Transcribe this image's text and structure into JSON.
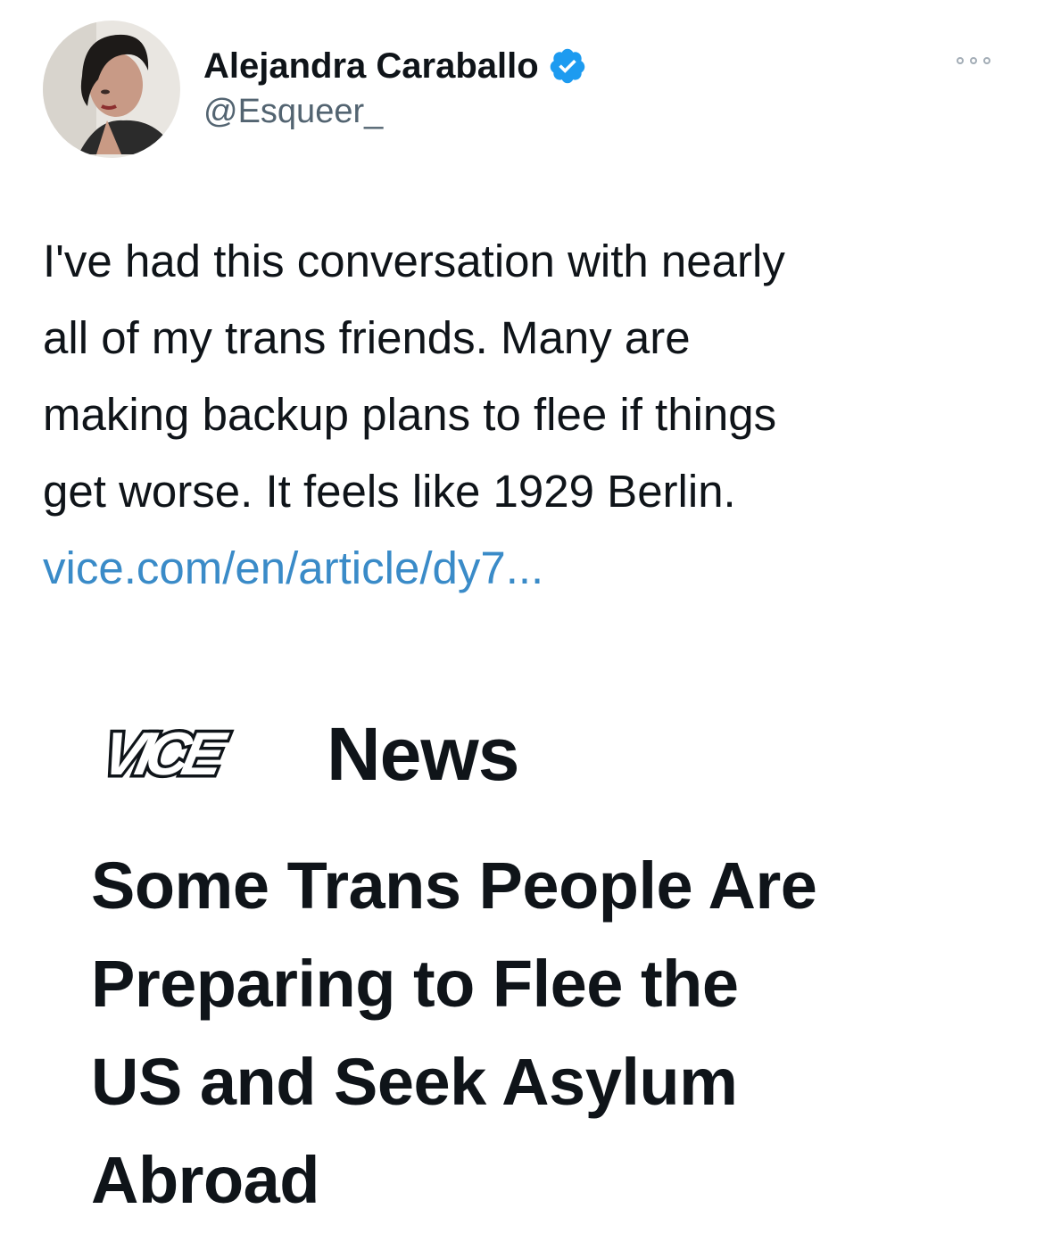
{
  "author": {
    "name": "Alejandra Caraballo",
    "handle": "@Esqueer_",
    "verified": true
  },
  "more_icon": "more-horizontal-icon",
  "tweet": {
    "text_lines": [
      "I've had this conversation with nearly",
      "all of my trans friends. Many are",
      "making backup plans to flee if things",
      "get worse. It feels like 1929 Berlin."
    ],
    "link_text": "vice.com/en/article/dy7..."
  },
  "card": {
    "logo_text": "VICE",
    "section_label": "News",
    "headline_lines": [
      "Some Trans People Are",
      "Preparing to Flee the",
      "US and Seek Asylum",
      "Abroad"
    ]
  },
  "colors": {
    "link": "#3a8bc8",
    "verified_badge": "#1d9bf0",
    "handle": "#536471"
  }
}
